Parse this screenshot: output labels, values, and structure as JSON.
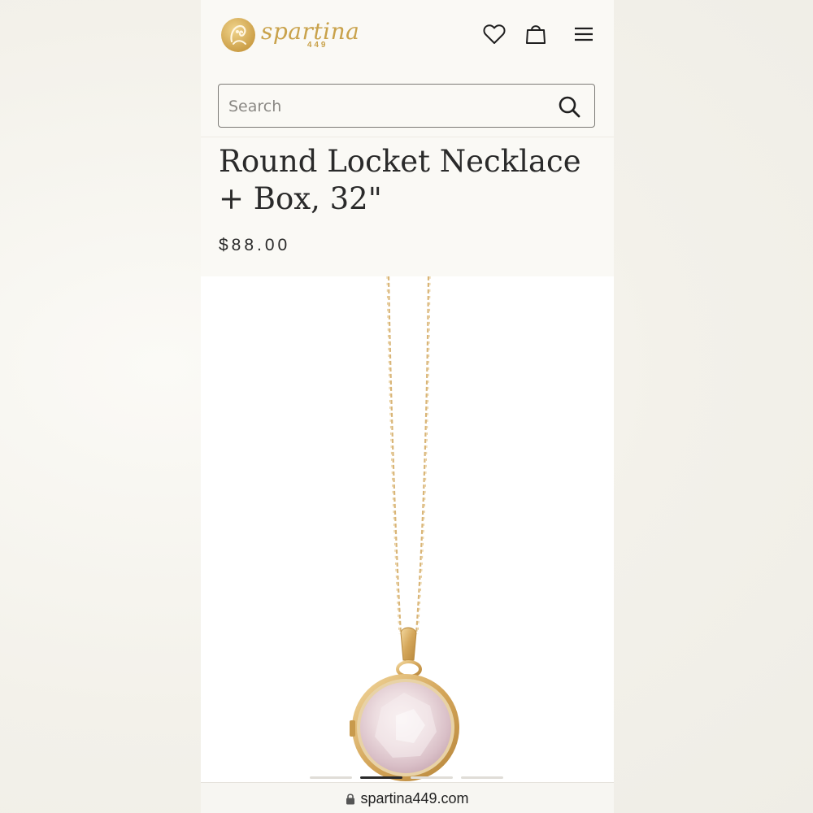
{
  "header": {
    "logo_name": "spartina",
    "logo_number": "449",
    "icons": {
      "wishlist": "heart-icon",
      "cart": "shopping-bag-icon",
      "menu": "hamburger-menu-icon"
    }
  },
  "search": {
    "placeholder": "Search",
    "value": "",
    "icon": "search-icon"
  },
  "product": {
    "title": "Round Locket Necklace + Box, 32\"",
    "price": "$88.00",
    "image_alt": "gold-round-locket-necklace"
  },
  "carousel": {
    "count": 4,
    "active_index": 1
  },
  "browser": {
    "url": "spartina449.com",
    "lock_icon": "lock-icon"
  },
  "colors": {
    "brand_gold": "#c9a24b",
    "background": "#faf9f5",
    "text": "#2a2a2a"
  }
}
